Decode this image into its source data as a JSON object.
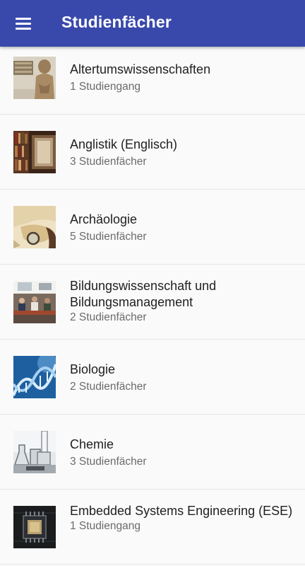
{
  "appbar": {
    "title": "Studienfächer",
    "menu_icon": "menu-icon",
    "color": "#3949ab"
  },
  "subjects": [
    {
      "name": "Altertumswissenschaften",
      "count": "1 Studiengang",
      "icon": "ancient-statue-image"
    },
    {
      "name": "Anglistik (Englisch)",
      "count": "3 Studienfächer",
      "icon": "library-books-image"
    },
    {
      "name": "Archäologie",
      "count": "5 Studienfächer",
      "icon": "archaeology-map-image"
    },
    {
      "name": "Bildungswissenschaft und Bildungsmanagement",
      "count": "2 Studienfächer",
      "icon": "classroom-image"
    },
    {
      "name": "Biologie",
      "count": "2 Studienfächer",
      "icon": "dna-helix-image"
    },
    {
      "name": "Chemie",
      "count": "3 Studienfächer",
      "icon": "lab-glassware-image"
    },
    {
      "name": "Embedded Systems Engineering (ESE)",
      "count": "1 Studiengang",
      "icon": "microchip-image"
    }
  ]
}
